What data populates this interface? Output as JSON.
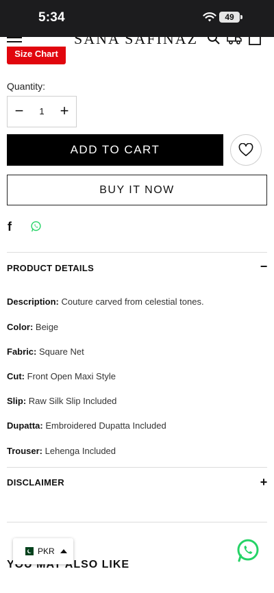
{
  "status_bar": {
    "time": "5:34",
    "battery": "49"
  },
  "header": {
    "brand": "SANA SAFINAZ"
  },
  "size_chart_label": "Size Chart",
  "quantity": {
    "label": "Quantity:",
    "value": "1",
    "minus": "−",
    "plus": "+"
  },
  "actions": {
    "add_to_cart": "ADD TO CART",
    "buy_now": "BUY IT NOW"
  },
  "share": {
    "facebook": "f"
  },
  "product_details": {
    "title": "PRODUCT DETAILS",
    "toggle": "−",
    "items": [
      {
        "label": "Description:",
        "value": "Couture carved from celestial tones."
      },
      {
        "label": "Color:",
        "value": "Beige"
      },
      {
        "label": "Fabric:",
        "value": "Square Net"
      },
      {
        "label": "Cut:",
        "value": "Front Open Maxi Style"
      },
      {
        "label": "Slip:",
        "value": "Raw Silk Slip Included"
      },
      {
        "label": "Dupatta:",
        "value": "Embroidered Dupatta Included"
      },
      {
        "label": "Trouser:",
        "value": "Lehenga Included"
      }
    ]
  },
  "disclaimer": {
    "title": "DISCLAIMER",
    "toggle": "+"
  },
  "also_like": "YOU MAY ALSO LIKE",
  "currency": {
    "code": "PKR"
  },
  "colors": {
    "accent_red": "#e1060e",
    "whatsapp_green": "#25d366",
    "black": "#000000"
  }
}
